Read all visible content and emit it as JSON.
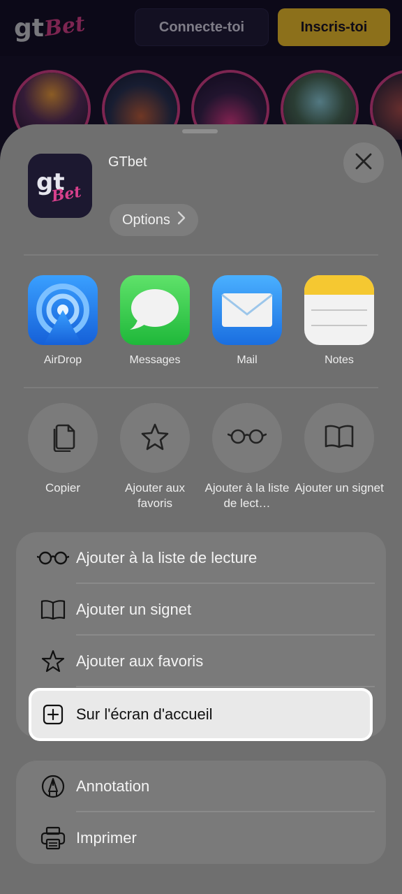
{
  "site": {
    "logo_text": "gtBet",
    "login_label": "Connecte-toi",
    "signup_label": "Inscris-toi",
    "story_colors": [
      "#3b2a5a",
      "#2a3356",
      "#3a2450",
      "#4a5a6a",
      "#3a2a40"
    ]
  },
  "share_sheet": {
    "app_name": "GTbet",
    "options_label": "Options",
    "app_targets": [
      {
        "label": "AirDrop",
        "icon": "airdrop-icon"
      },
      {
        "label": "Messages",
        "icon": "messages-icon"
      },
      {
        "label": "Mail",
        "icon": "mail-icon"
      },
      {
        "label": "Notes",
        "icon": "notes-icon"
      }
    ],
    "quick_actions": [
      {
        "label": "Copier",
        "icon": "copy-icon"
      },
      {
        "label": "Ajouter aux favoris",
        "icon": "star-icon"
      },
      {
        "label": "Ajouter à la liste de lect…",
        "icon": "glasses-icon"
      },
      {
        "label": "Ajouter un signet",
        "icon": "book-icon"
      }
    ],
    "list_group_1": [
      {
        "label": "Ajouter à la liste de lecture",
        "icon": "glasses-icon"
      },
      {
        "label": "Ajouter un signet",
        "icon": "book-icon"
      },
      {
        "label": "Ajouter aux favoris",
        "icon": "star-icon"
      },
      {
        "label": "Sur l'écran d'accueil",
        "icon": "add-square-icon",
        "highlighted": true
      }
    ],
    "list_group_2": [
      {
        "label": "Annotation",
        "icon": "markup-icon"
      },
      {
        "label": "Imprimer",
        "icon": "printer-icon"
      }
    ]
  },
  "colors": {
    "brand_pink": "#d8408c",
    "brand_yellow": "#f2c230",
    "sheet_bg": "#6f6f6f"
  }
}
